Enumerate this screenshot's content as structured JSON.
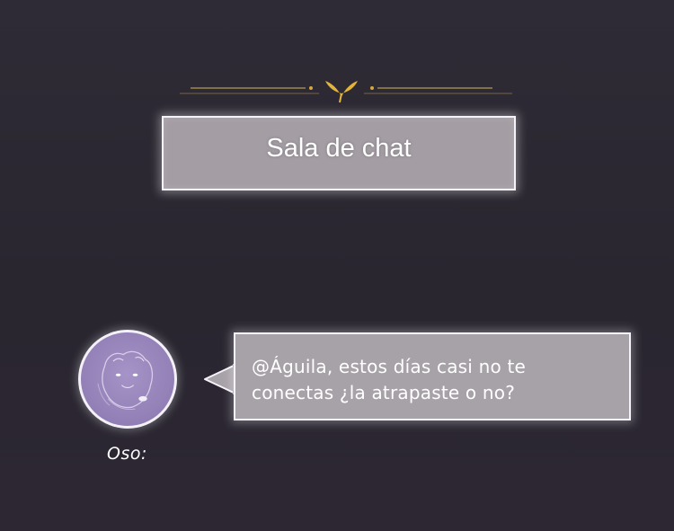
{
  "header": {
    "title": "Sala de chat"
  },
  "message": {
    "speaker": "Oso:",
    "lines": [
      "@Águila, estos días casi no te",
      "conectas ¿la atrapaste o no?"
    ],
    "avatar_icon": "bear-avatar-icon"
  },
  "colors": {
    "background": "#2d2933",
    "box_fill": "#a49ea4",
    "avatar_fill": "#9482b8",
    "ornament_gold": "#d6a93a",
    "border_white": "#f6f2fa"
  }
}
